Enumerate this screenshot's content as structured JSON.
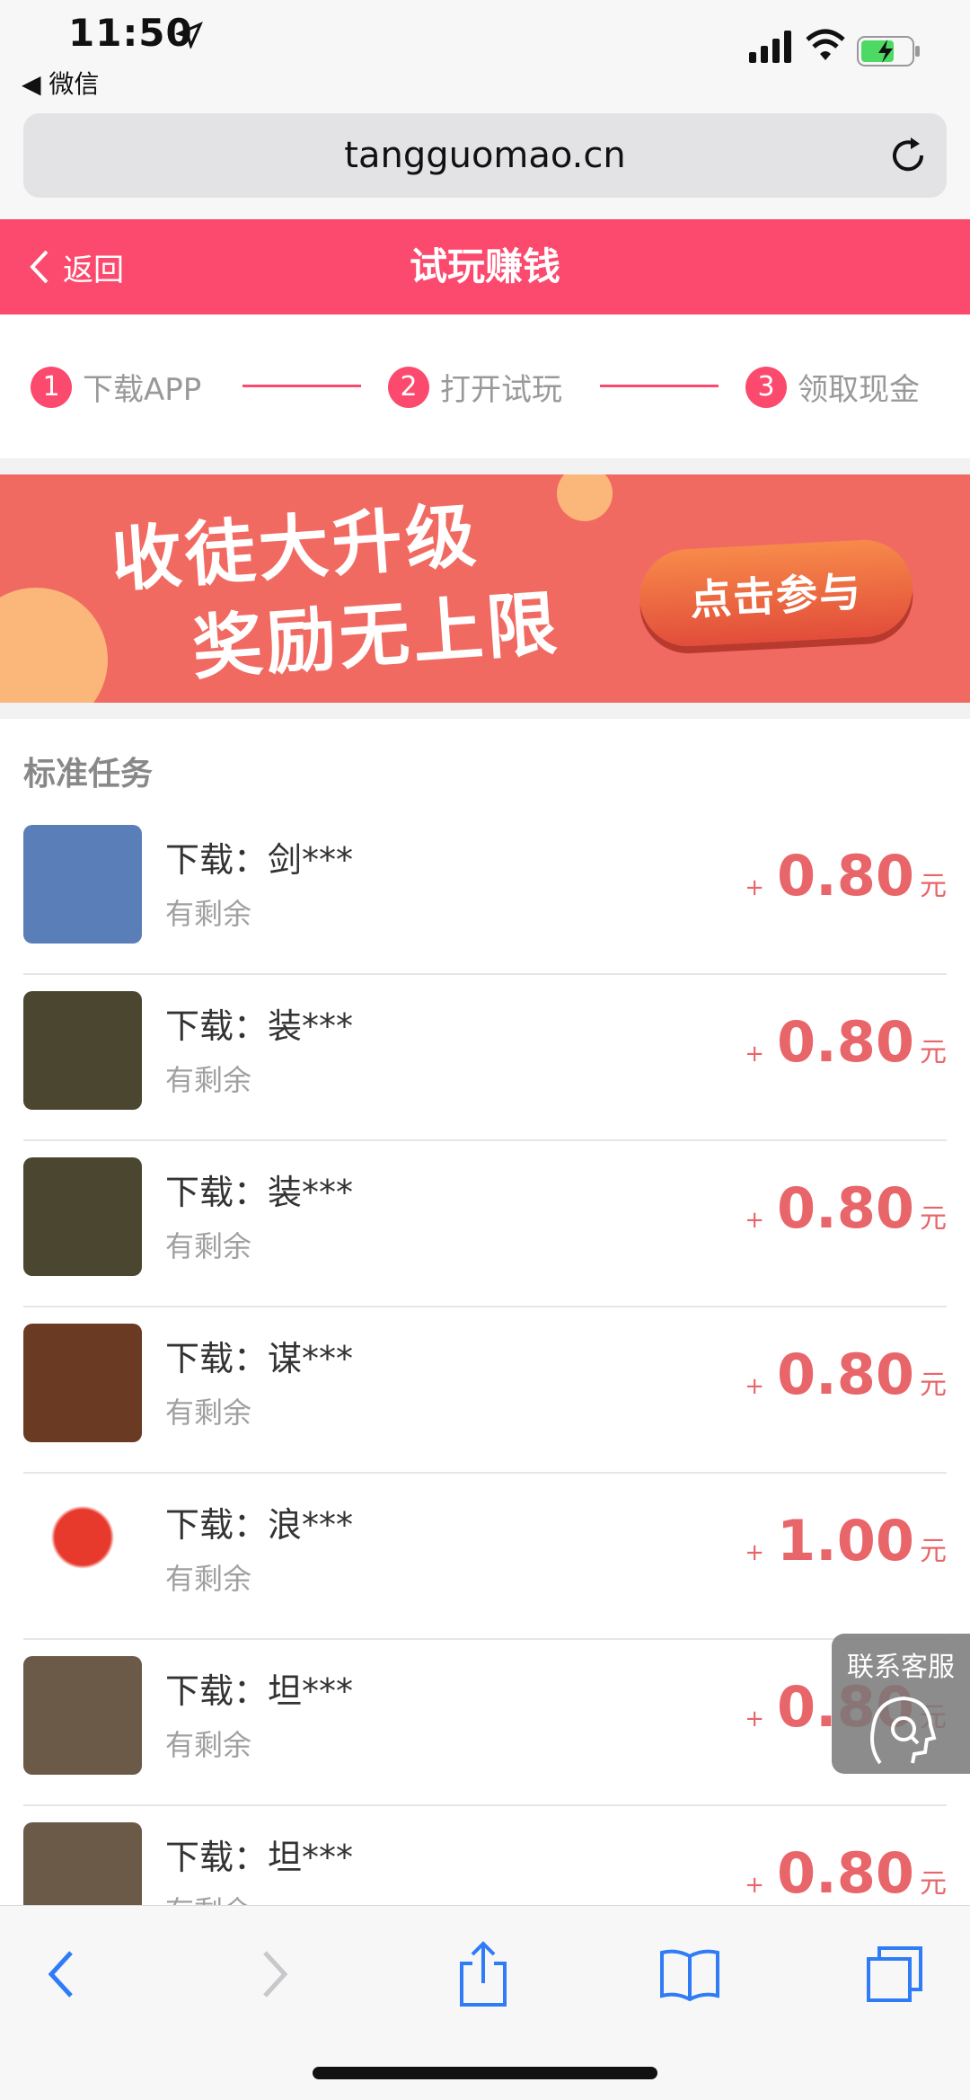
{
  "status": {
    "time": "11:50",
    "back_app": "◀ 微信"
  },
  "url": {
    "domain": "tangguomao.cn"
  },
  "header": {
    "back_label": "返回",
    "title": "试玩赚钱"
  },
  "steps": [
    {
      "num": "1",
      "label": "下载APP"
    },
    {
      "num": "2",
      "label": "打开试玩"
    },
    {
      "num": "3",
      "label": "领取现金"
    }
  ],
  "banner": {
    "line1": "收徒大升级",
    "line2": "奖励无上限",
    "cta": "点击参与"
  },
  "section": {
    "title": "标准任务"
  },
  "tasks": [
    {
      "name": "下载：剑***",
      "status": "有剩余",
      "plus": "+",
      "amount": "0.80",
      "unit": "元",
      "thumb_color": "#5a7fb8"
    },
    {
      "name": "下载：装***",
      "status": "有剩余",
      "plus": "+",
      "amount": "0.80",
      "unit": "元",
      "thumb_color": "#4a4630"
    },
    {
      "name": "下载：装***",
      "status": "有剩余",
      "plus": "+",
      "amount": "0.80",
      "unit": "元",
      "thumb_color": "#4a4630"
    },
    {
      "name": "下载：谋***",
      "status": "有剩余",
      "plus": "+",
      "amount": "0.80",
      "unit": "元",
      "thumb_color": "#6a3a22"
    },
    {
      "name": "下载：浪***",
      "status": "有剩余",
      "plus": "+",
      "amount": "1.00",
      "unit": "元",
      "thumb_color": "#e83a2c"
    },
    {
      "name": "下载：坦***",
      "status": "有剩余",
      "plus": "+",
      "amount": "0.80",
      "unit": "元",
      "thumb_color": "#6b5a48"
    },
    {
      "name": "下载：坦***",
      "status": "有剩余",
      "plus": "+",
      "amount": "0.80",
      "unit": "元",
      "thumb_color": "#6b5a48"
    }
  ],
  "service": {
    "label": "联系客服"
  },
  "colors": {
    "accent": "#fb4a6e",
    "reward": "#e8656a",
    "banner": "#f16a62"
  }
}
